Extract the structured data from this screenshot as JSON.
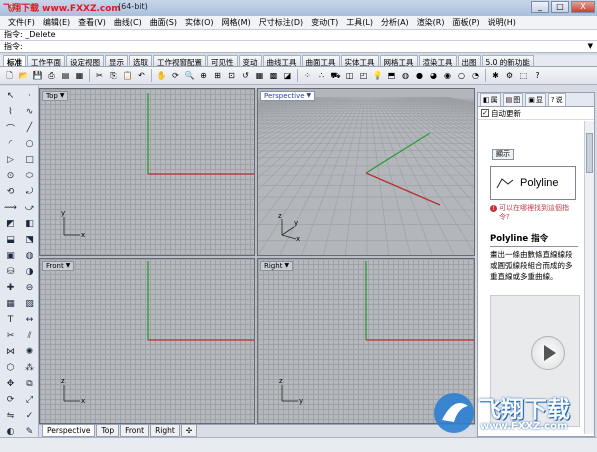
{
  "title": {
    "watermark": "飞翔下载 www.FXXZ.com",
    "window_title": "(64-bit)",
    "controls": [
      "_",
      "□",
      "X"
    ]
  },
  "menu": [
    "文件(F)",
    "编辑(E)",
    "查看(V)",
    "曲线(C)",
    "曲面(S)",
    "实体(O)",
    "网格(M)",
    "尺寸标注(D)",
    "变动(T)",
    "工具(L)",
    "分析(A)",
    "渲染(R)",
    "面板(P)",
    "说明(H)"
  ],
  "command": {
    "history_label": "指令:",
    "history_value": "_Delete",
    "prompt_label": "指令:",
    "prompt_value": ""
  },
  "tabs": [
    "标准",
    "工作平面",
    "设定视图",
    "显示",
    "选取",
    "工作视窗配置",
    "可见性",
    "变动",
    "曲线工具",
    "曲面工具",
    "实体工具",
    "网格工具",
    "渲染工具",
    "出图",
    "5.0 的新功能"
  ],
  "viewports": [
    {
      "label": "Top",
      "axes": [
        "y",
        "x"
      ]
    },
    {
      "label": "Perspective",
      "axes": [
        "z",
        "y",
        "x"
      ]
    },
    {
      "label": "Front",
      "axes": [
        "z",
        "x"
      ]
    },
    {
      "label": "Right",
      "axes": [
        "z",
        "y"
      ]
    }
  ],
  "viewport_tabs": [
    "Perspective",
    "Top",
    "Front",
    "Right",
    "✣"
  ],
  "panel": {
    "tabs": [
      "属",
      "图",
      "显",
      "说"
    ],
    "auto_update": "自动更新",
    "display_button": "顯示",
    "command_name": "Polyline",
    "question": "可以在哪裡找到這個指令?",
    "help_title": "Polyline 指令",
    "help_desc": "畫出一條由數條直線線段或圓弧線段組合而成的多重直線或多重曲線。"
  },
  "logo": {
    "text": "飞翔下载",
    "url": "www.FXXZ.com"
  },
  "colors": {
    "x_axis": "#b53232",
    "y_axis": "#2f9a36",
    "grid": "#9fa3a8"
  }
}
